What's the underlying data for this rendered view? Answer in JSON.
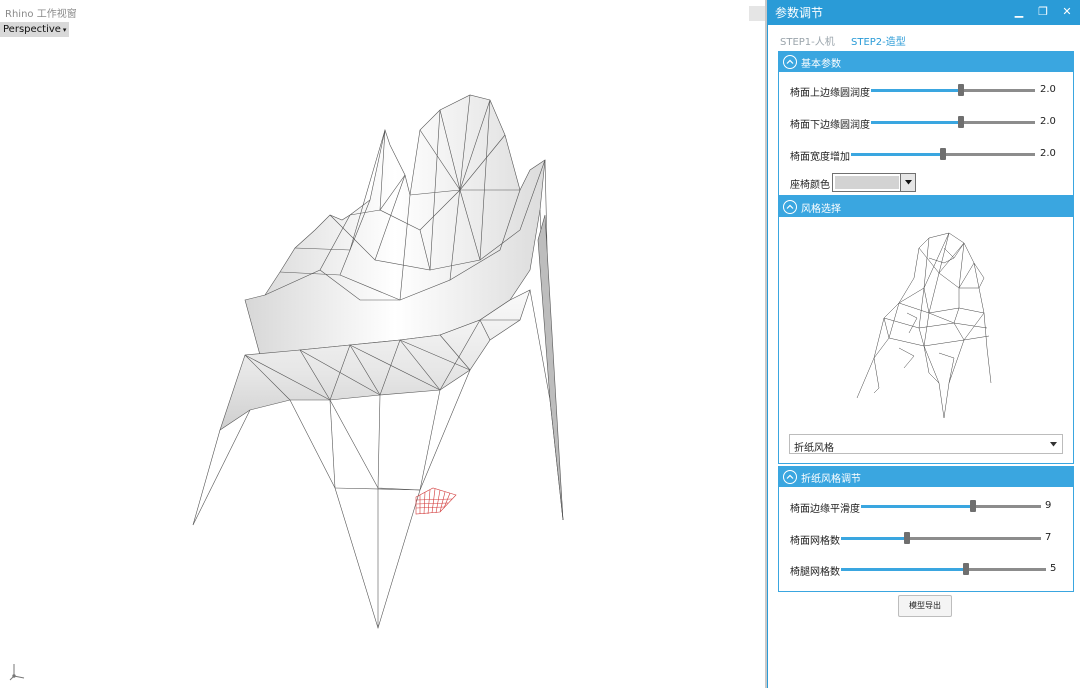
{
  "viewport": {
    "title": "Rhino 工作视窗",
    "view_label": "Perspective",
    "view_caret": "▾"
  },
  "panel": {
    "title": "参数调节",
    "controls": {
      "minimize": "▁",
      "maximize": "❐",
      "close": "✕"
    },
    "steps": [
      "STEP1-人机",
      "STEP2-造型"
    ],
    "active_step": 1,
    "sections": [
      {
        "title": "基本参数",
        "sliders": [
          {
            "label": "椅面上边缘圆润度",
            "value": "2.0",
            "fraction": 0.55
          },
          {
            "label": "椅面下边缘圆润度",
            "value": "2.0",
            "fraction": 0.55
          },
          {
            "label": "椅面宽度增加",
            "value": "2.0",
            "fraction": 0.5
          }
        ],
        "color_label": "座椅颜色",
        "color_value": "#d3d3d3"
      },
      {
        "title": "风格选择",
        "style_value": "折纸风格"
      },
      {
        "title": "折纸风格调节",
        "sliders": [
          {
            "label": "椅面边缘平滑度",
            "value": "9",
            "fraction": 0.62
          },
          {
            "label": "椅面网格数",
            "value": "7",
            "fraction": 0.33
          },
          {
            "label": "椅腿网格数",
            "value": "5",
            "fraction": 0.61
          }
        ]
      }
    ],
    "export_label": "模型导出"
  },
  "colors": {
    "accent": "#2a9bd7",
    "section_header": "#3aa6e0",
    "slider_track": "#8c8c8c",
    "slider_thumb": "#6f6f6f",
    "grid": "#d23a3a"
  },
  "icons": {
    "section_toggle": "chevron-up-icon",
    "dropdown": "chevron-down-icon",
    "axis": "axis-icon"
  }
}
